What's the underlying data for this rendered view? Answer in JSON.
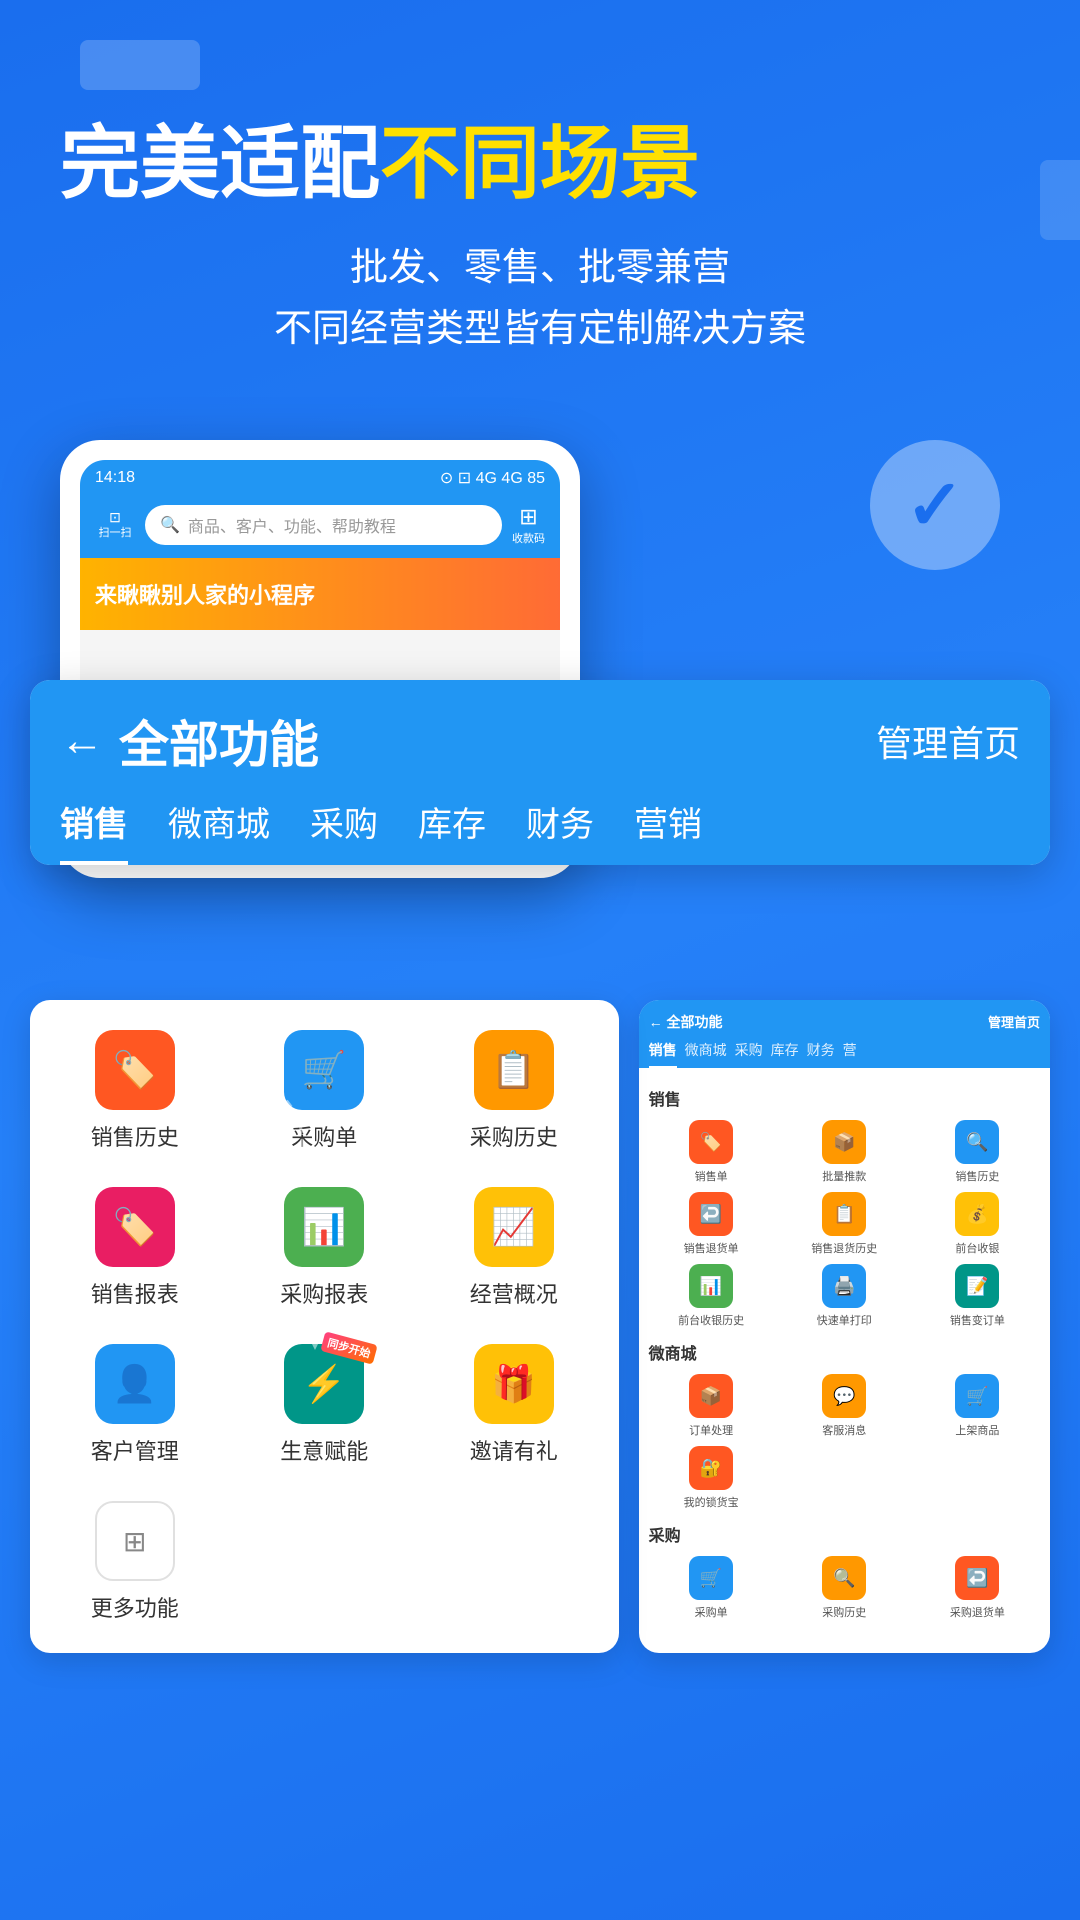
{
  "background": {
    "color": "#1a6eee"
  },
  "hero": {
    "title_white": "完美适配",
    "title_yellow": "不同场景",
    "subtitle_line1": "批发、零售、批零兼营",
    "subtitle_line2": "不同经营类型皆有定制解决方案"
  },
  "phone_mockup": {
    "time": "14:18",
    "search_placeholder": "商品、客户、功能、帮助教程",
    "scan_label": "扫一扫",
    "qr_label": "收款码",
    "banner_text": "来瞅瞅别人家的小程序"
  },
  "main_panel": {
    "back_label": "←",
    "title": "全部功能",
    "right_link": "管理首页",
    "tabs": [
      "销售",
      "微商城",
      "采购",
      "库存",
      "财务",
      "营销"
    ]
  },
  "icon_grid": {
    "items": [
      {
        "icon": "🏷️",
        "label": "销售历史",
        "color": "red"
      },
      {
        "icon": "➕",
        "label": "采购单",
        "color": "blue"
      },
      {
        "icon": "📋",
        "label": "采购历史",
        "color": "orange"
      },
      {
        "icon": "🏷️",
        "label": "销售报表",
        "color": "pink"
      },
      {
        "icon": "➕",
        "label": "采购报表",
        "color": "green"
      },
      {
        "icon": "📈",
        "label": "经营概况",
        "color": "yellow"
      },
      {
        "icon": "👤",
        "label": "客户管理",
        "color": "blue"
      },
      {
        "icon": "⚡",
        "label": "生意赋能",
        "color": "teal",
        "badge": "同步开始"
      },
      {
        "icon": "🎁",
        "label": "邀请有礼",
        "color": "yellow"
      }
    ],
    "more_label": "更多功能"
  },
  "mini_panel": {
    "back_label": "← 全部功能",
    "right_link": "管理首页",
    "tabs": [
      "销售",
      "微商城",
      "采购",
      "库存",
      "财务",
      "营"
    ],
    "sections": [
      {
        "title": "销售",
        "icons": [
          {
            "label": "销售单",
            "color": "red"
          },
          {
            "label": "批量推款",
            "color": "orange"
          },
          {
            "label": "销售历史",
            "color": "blue"
          },
          {
            "label": "销售退货单",
            "color": "red"
          },
          {
            "label": "销售退货历史",
            "color": "orange"
          },
          {
            "label": "前台收银",
            "color": "yellow"
          },
          {
            "label": "前台收银历史",
            "color": "green"
          },
          {
            "label": "快速单打印",
            "color": "blue"
          },
          {
            "label": "销售变订单",
            "color": "teal"
          }
        ]
      },
      {
        "title": "微商城",
        "icons": [
          {
            "label": "订单处理",
            "color": "red"
          },
          {
            "label": "客服消息",
            "color": "orange"
          },
          {
            "label": "上架商品",
            "color": "blue"
          },
          {
            "label": "我的锁货宝",
            "color": "red"
          }
        ]
      },
      {
        "title": "采购",
        "icons": [
          {
            "label": "采购单",
            "color": "blue"
          },
          {
            "label": "采购历史",
            "color": "orange"
          },
          {
            "label": "采购退货单",
            "color": "red"
          }
        ]
      }
    ]
  }
}
